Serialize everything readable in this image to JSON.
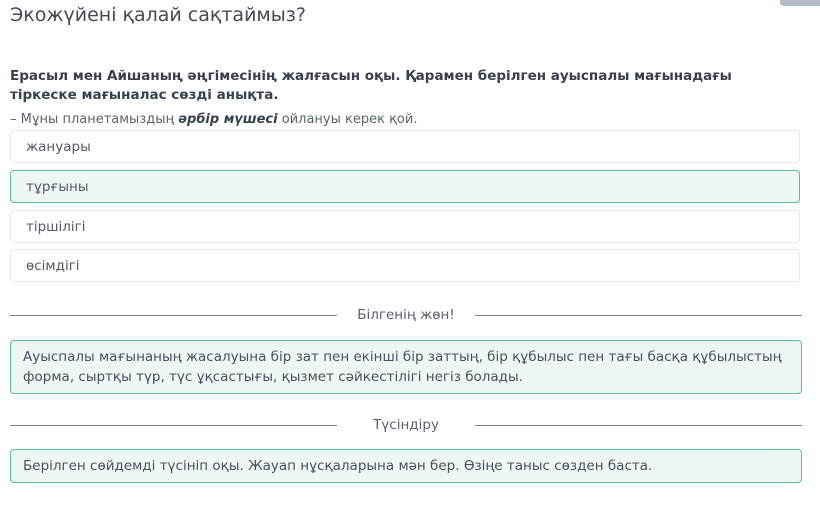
{
  "page": {
    "title": "Экожүйені қалай сақтаймыз?"
  },
  "question": {
    "prompt": "Ерасыл мен Айшаның әңгімесінің жалғасын оқы. Қарамен берілген ауыспалы мағынадағы тіркеске мағыналас сөзді анықта.",
    "quote_before": "– Мұны планетамыздың ",
    "quote_bold": "әрбір мүшесі",
    "quote_after": " ойлануы керек қой."
  },
  "options": [
    {
      "label": "жануары",
      "state": "default"
    },
    {
      "label": "тұрғыны",
      "state": "correct"
    },
    {
      "label": "тіршілігі",
      "state": "default"
    },
    {
      "label": "өсімдігі",
      "state": "default"
    }
  ],
  "know_section": {
    "heading": "Білгенің жөн!",
    "text": "Ауыспалы мағынаның жасалуына бір зат пен екінші бір заттың, бір құбылыс пен тағы басқа құбылыстың форма, сыртқы түр, түс ұқсастығы, қызмет сәйкестілігі негіз болады."
  },
  "explanation_section": {
    "heading": "Түсіндіру",
    "text": "Берілген сөйдемді түсініп оқы. Жауап нұсқаларына мән бер. Өзіңе таныс сөзден баста."
  },
  "colors": {
    "correct_border": "#5dbf96",
    "correct_bg": "#edf8f3",
    "option_border": "#e6e9ee"
  }
}
